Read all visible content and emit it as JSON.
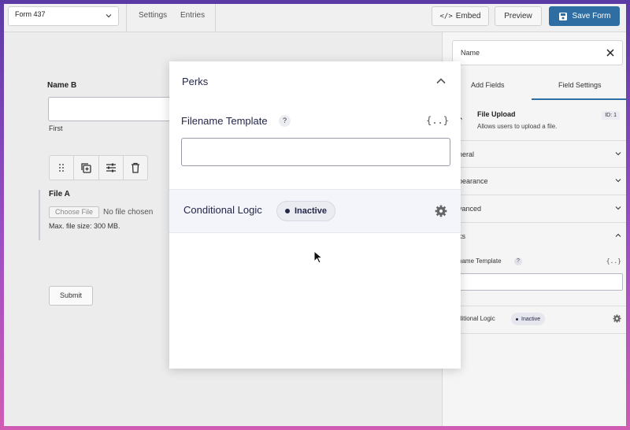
{
  "topbar": {
    "form_name": "Form 437",
    "links": [
      "Settings",
      "Entries"
    ],
    "embed_label": "Embed",
    "preview_label": "Preview",
    "save_label": "Save Form"
  },
  "canvas": {
    "name_label": "Name B",
    "name_sublabel": "First",
    "file_label": "File A",
    "choose_file": "Choose File",
    "no_file": "No file chosen",
    "max_size": "Max. file size: 300 MB.",
    "submit_label": "Submit"
  },
  "panel": {
    "search_value": "Name",
    "tabs": [
      "Add Fields",
      "Field Settings"
    ],
    "field_title": "File Upload",
    "field_desc": "Allows users to upload a file.",
    "field_id": "ID: 1",
    "sections": [
      "neral",
      "pearance",
      "vanced",
      "ks"
    ],
    "filename_label": "name Template",
    "question_mark": "?",
    "merge_icon": "{..}",
    "cond_label": "ditional Logic",
    "cond_status": "Inactive"
  },
  "modal": {
    "title": "Perks",
    "filename_label": "Filename Template",
    "question_mark": "?",
    "merge_tag": "{..}",
    "filename_value": "",
    "cond_label": "Conditional Logic",
    "cond_status": "Inactive"
  },
  "colors": {
    "accent": "#2f6ea3",
    "text": "#242748"
  }
}
